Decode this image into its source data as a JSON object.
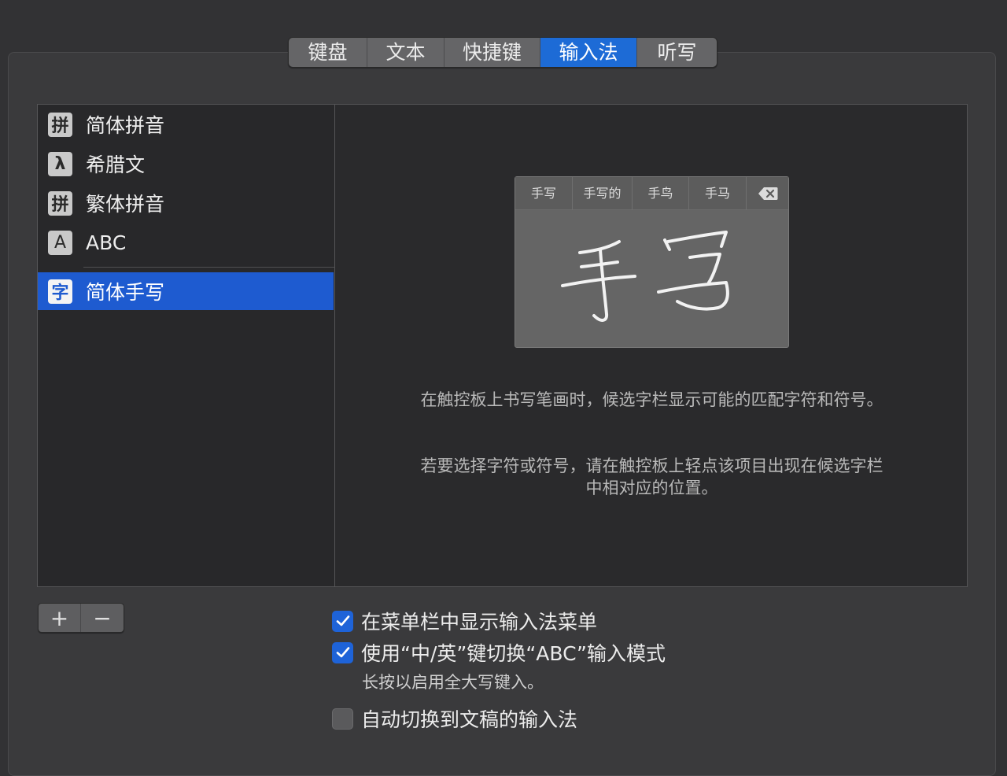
{
  "tabs": [
    {
      "label": "键盘",
      "selected": false
    },
    {
      "label": "文本",
      "selected": false
    },
    {
      "label": "快捷键",
      "selected": false
    },
    {
      "label": "输入法",
      "selected": true
    },
    {
      "label": "听写",
      "selected": false
    }
  ],
  "input_sources": [
    {
      "badge": "拼",
      "label": "简体拼音"
    },
    {
      "badge": "λ",
      "label": "希腊文"
    },
    {
      "badge": "拼",
      "label": "繁体拼音"
    },
    {
      "badge": "A",
      "label": "ABC"
    },
    {
      "badge": "字",
      "label": "简体手写",
      "selected": true
    }
  ],
  "handwriting": {
    "candidates": [
      "手写",
      "手写的",
      "手鸟",
      "手马"
    ],
    "delete_icon": "delete-backward-icon"
  },
  "description": {
    "p1": "在触控板上书写笔画时，候选字栏显示可能的匹配字符和符号。",
    "p2": "若要选择字符或符号，请在触控板上轻点该项目出现在候选字栏中相对应的位置。"
  },
  "buttons": {
    "add": "+",
    "remove": "−"
  },
  "options": {
    "show_menu": {
      "label": "在菜单栏中显示输入法菜单",
      "checked": true
    },
    "use_key": {
      "label": "使用“中/英”键切换“ABC”输入模式",
      "checked": true
    },
    "use_key_note": "长按以启用全大写键入。",
    "auto_switch": {
      "label": "自动切换到文稿的输入法",
      "checked": false
    }
  },
  "colors": {
    "accent": "#1e5bd0",
    "checkbox_on": "#1e63d8"
  }
}
